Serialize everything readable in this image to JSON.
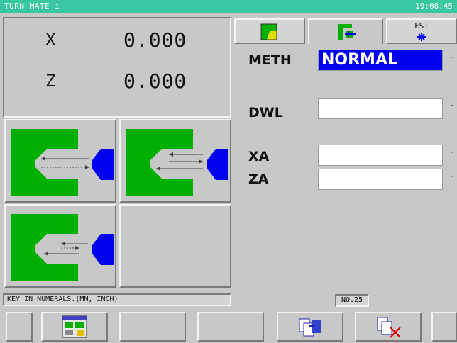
{
  "title": "TURN MATE i",
  "clock": "19:08:45",
  "position": {
    "x_label": "X",
    "x_value": "0.000",
    "z_label": "Z",
    "z_value": "0.000"
  },
  "tabs": {
    "fst_label": "FST"
  },
  "fields": {
    "meth_label": "METH",
    "meth_value": "NORMAL",
    "dwl_label": "DWL",
    "xa_label": "XA",
    "za_label": "ZA",
    "dot": "·"
  },
  "status": {
    "message": "KEY IN NUMERALS.(MM, INCH)",
    "number": "NO.25"
  },
  "colors": {
    "title_bar": "#38c8a0",
    "workpiece": "#00b000",
    "tool": "#0000ee"
  },
  "icons": {
    "tab1": "face-groove-icon",
    "tab2": "bore-icon",
    "tab3": "fst-icon",
    "softkey2": "data-table-icon",
    "softkey5": "copy-icon",
    "softkey6": "delete-icon"
  }
}
